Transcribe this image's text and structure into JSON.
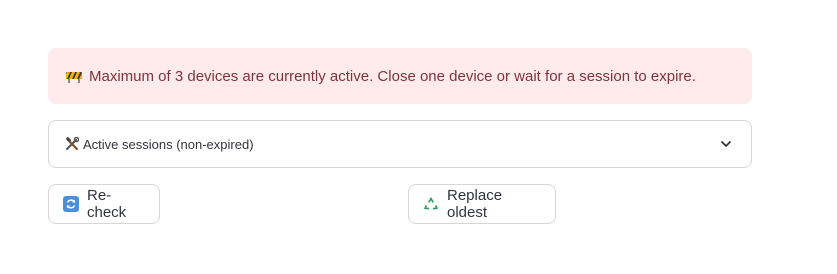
{
  "alert": {
    "icon": "construction-barrier-icon",
    "message": "Maximum of 3 devices are currently active. Close one device or wait for a session to expire.",
    "color_background": "#ffebeb",
    "color_text": "#7d353b"
  },
  "expander": {
    "icon": "hammer-and-wrench-icon",
    "label": "Active sessions (non-expired)",
    "state": "collapsed",
    "chevron": "chevron-down-icon"
  },
  "buttons": {
    "recheck": {
      "icon": "counterclockwise-arrows-icon",
      "label": "Re-check"
    },
    "replace_oldest": {
      "icon": "recycle-icon",
      "label": "Replace oldest"
    }
  }
}
